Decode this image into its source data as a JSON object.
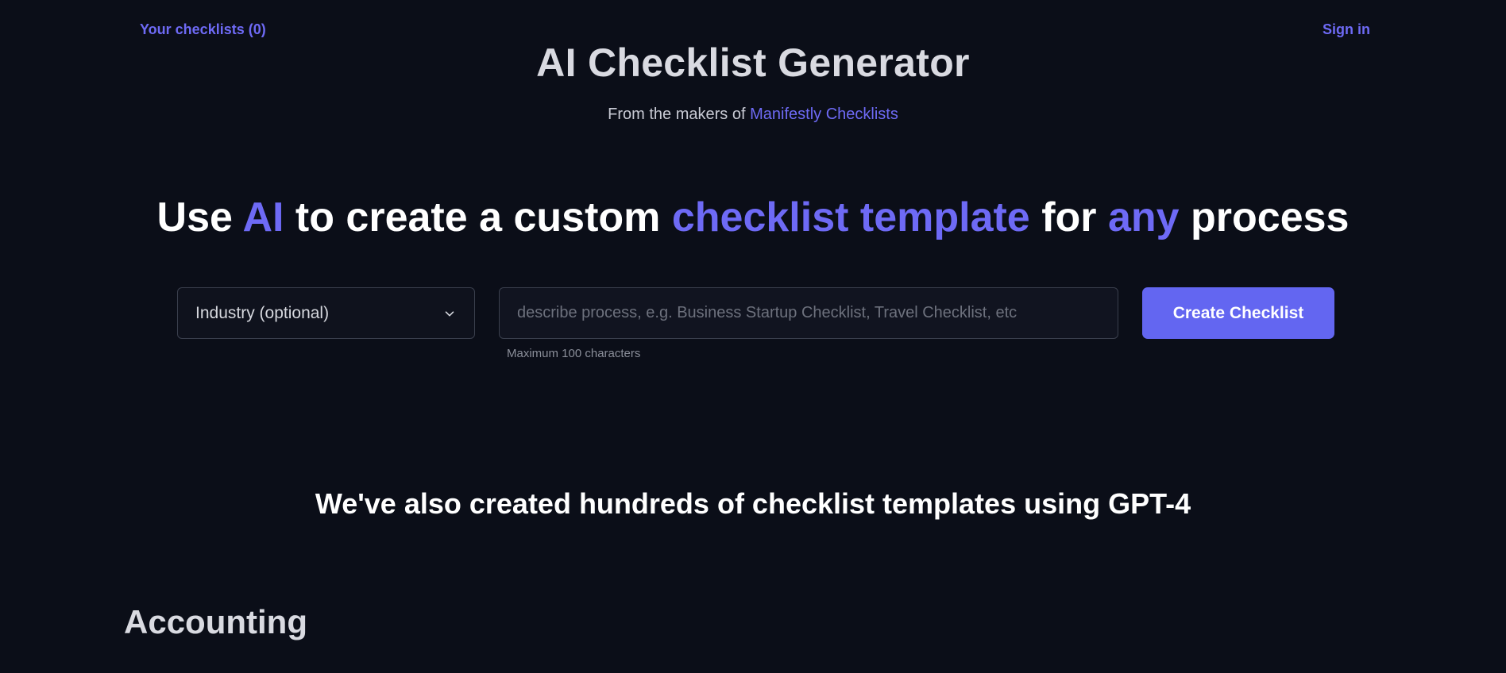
{
  "nav": {
    "your_checklists": "Your checklists (0)",
    "sign_in": "Sign in"
  },
  "header": {
    "title": "AI Checklist Generator",
    "subtitle_prefix": "From the makers of",
    "subtitle_link": "Manifestly Checklists"
  },
  "headline": {
    "part1": "Use",
    "hl1": "AI",
    "part2": "to create a custom",
    "hl2": "checklist template",
    "part3": "for",
    "hl3": "any",
    "part4": "process"
  },
  "form": {
    "industry_select": "Industry (optional)",
    "process_placeholder": "describe process, e.g. Business Startup Checklist, Travel Checklist, etc",
    "process_value": "",
    "hint": "Maximum 100 characters",
    "submit_label": "Create Checklist"
  },
  "templates": {
    "subtitle": "We've also created hundreds of checklist templates using GPT-4",
    "first_category": "Accounting"
  },
  "colors": {
    "background": "#0b0e18",
    "accent": "#6366f1",
    "link": "#6e6af5"
  },
  "icons": {
    "select_arrow": "chevron-down-icon"
  }
}
